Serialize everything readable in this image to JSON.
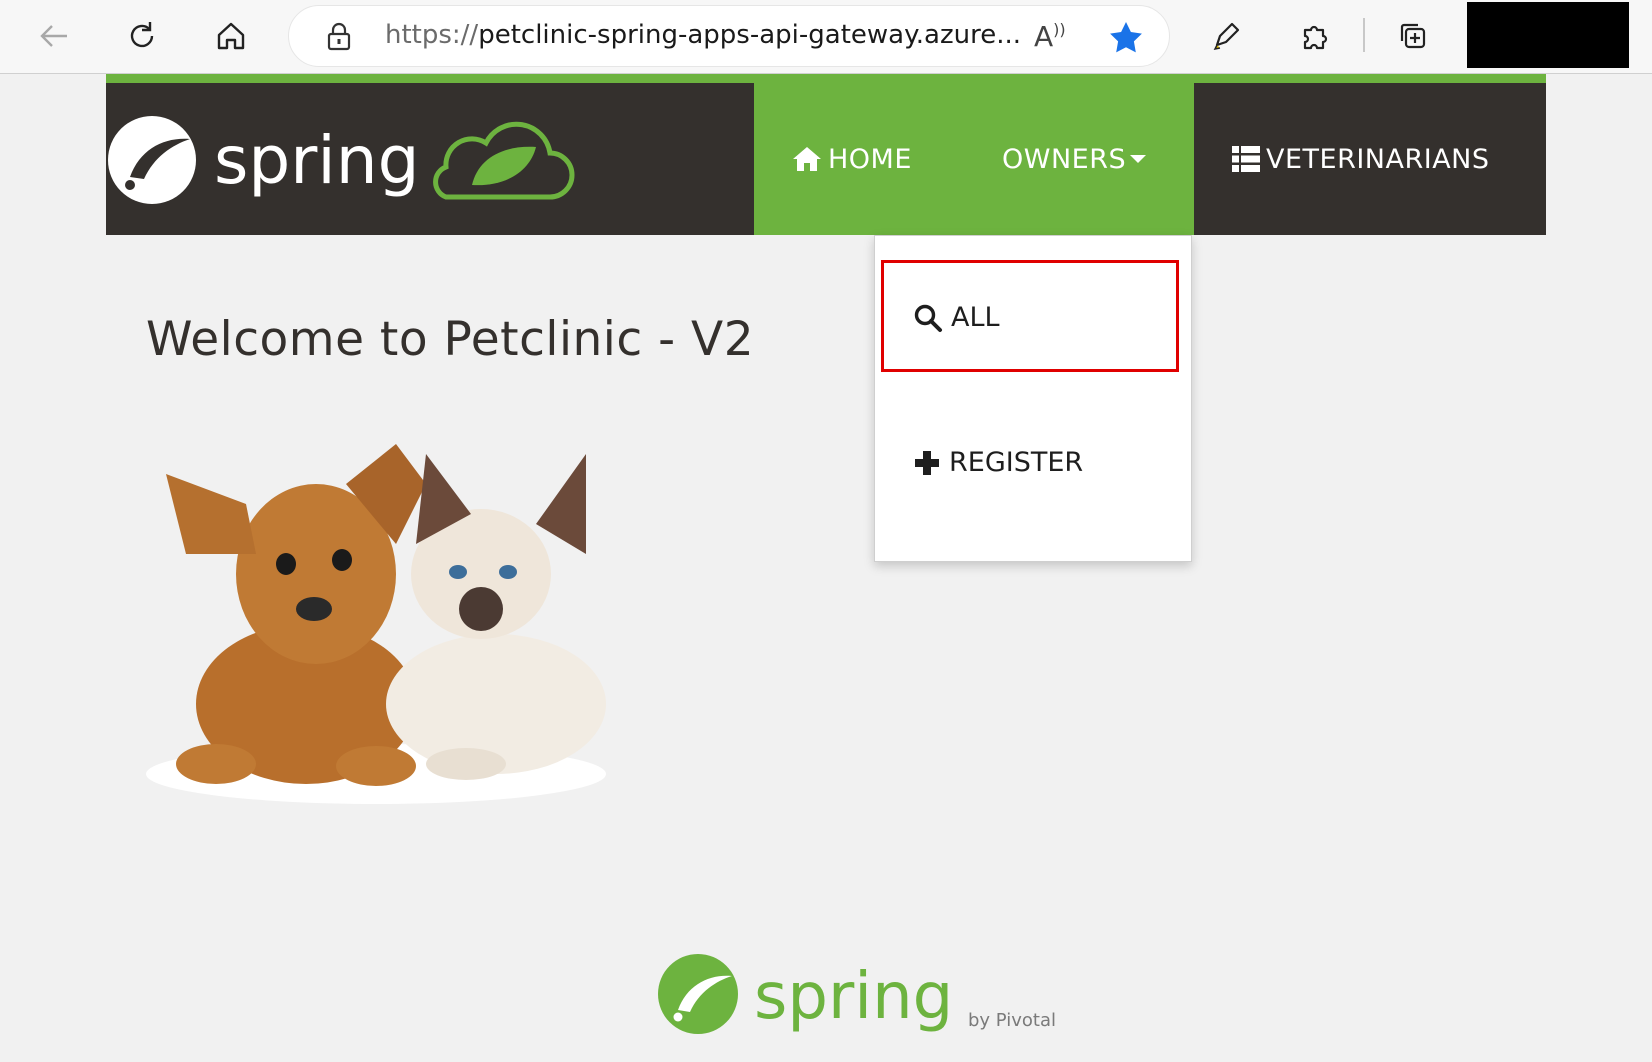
{
  "browser": {
    "url_protocol": "https://",
    "url_rest": "petclinic-spring-apps-api-gateway.azure...",
    "read_aloud_label": "A",
    "icons": [
      "back-arrow-icon",
      "refresh-icon",
      "home-icon",
      "lock-icon",
      "read-aloud-icon",
      "star-icon",
      "pen-icon",
      "extensions-icon",
      "collections-icon"
    ]
  },
  "header": {
    "brand": "spring",
    "nav": {
      "home": "HOME",
      "owners": "OWNERS",
      "veterinarians": "VETERINARIANS"
    }
  },
  "dropdown": {
    "all": "ALL",
    "register": "REGISTER"
  },
  "main": {
    "title": "Welcome to Petclinic - V2"
  },
  "footer": {
    "brand": "spring",
    "byline": "by Pivotal."
  },
  "colors": {
    "spring_green": "#6db33f",
    "navbar_dark": "#34302d",
    "highlight_red": "#e00000"
  }
}
